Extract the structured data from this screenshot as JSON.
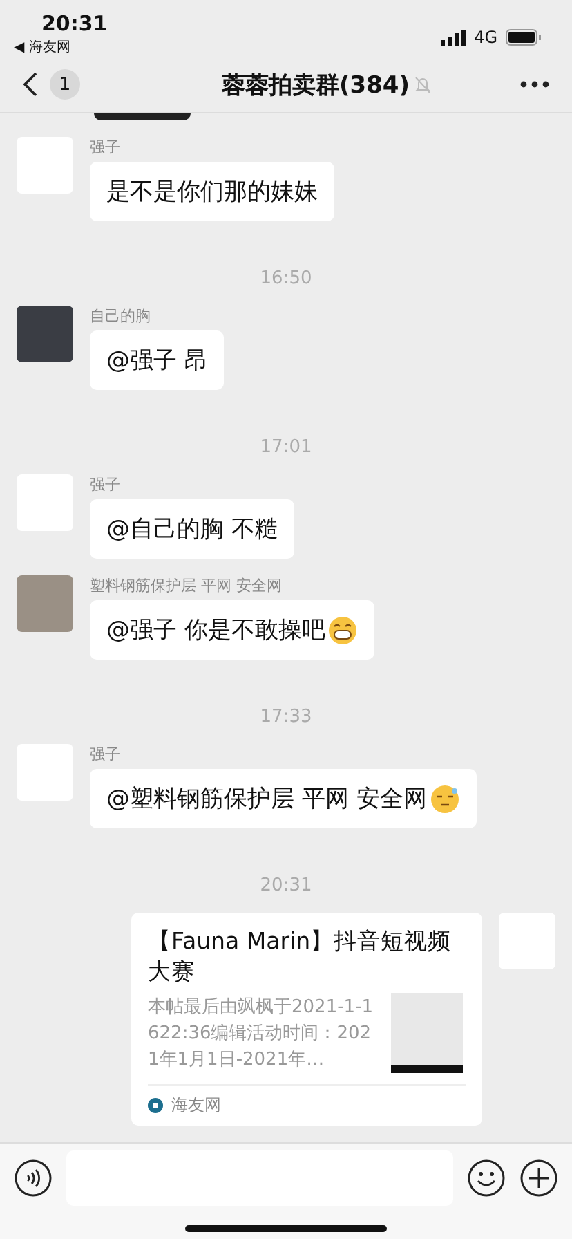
{
  "status_bar": {
    "time": "20:31",
    "back_app": "◀ 海友网",
    "network": "4G"
  },
  "header": {
    "unread": "1",
    "title": "蓉蓉拍卖群(384)",
    "muted": true
  },
  "messages": [
    {
      "kind": "text",
      "sender": "强子",
      "avatar": {
        "kind": "cat"
      },
      "text": "是不是你们那的妹妹"
    },
    {
      "kind": "time",
      "text": "16:50"
    },
    {
      "kind": "text",
      "sender": "自己的胸",
      "avatar": {
        "kind": "dark"
      },
      "text": "@强子 昂"
    },
    {
      "kind": "time",
      "text": "17:01"
    },
    {
      "kind": "text",
      "sender": "强子",
      "avatar": {
        "kind": "cat"
      },
      "text": "@自己的胸 不糙"
    },
    {
      "kind": "text",
      "sender": "塑料钢筋保护层 平网 安全网",
      "avatar": {
        "kind": "photo"
      },
      "text": "@强子 你是不敢操吧",
      "emoji": {
        "kind": "grin"
      }
    },
    {
      "kind": "time",
      "text": "17:33"
    },
    {
      "kind": "text",
      "sender": "强子",
      "avatar": {
        "kind": "cat"
      },
      "text": "@塑料钢筋保护层 平网 安全网",
      "emoji": {
        "kind": "sleepy"
      }
    },
    {
      "kind": "time",
      "text": "20:31"
    },
    {
      "kind": "link",
      "avatar": {
        "kind": "sailor"
      },
      "title": "【Fauna Marin】抖音短视频大赛",
      "description": "本帖最后由飒枫于2021-1-1622:36编辑活动时间：2021年1月1日-2021年…",
      "source": "海友网"
    }
  ]
}
